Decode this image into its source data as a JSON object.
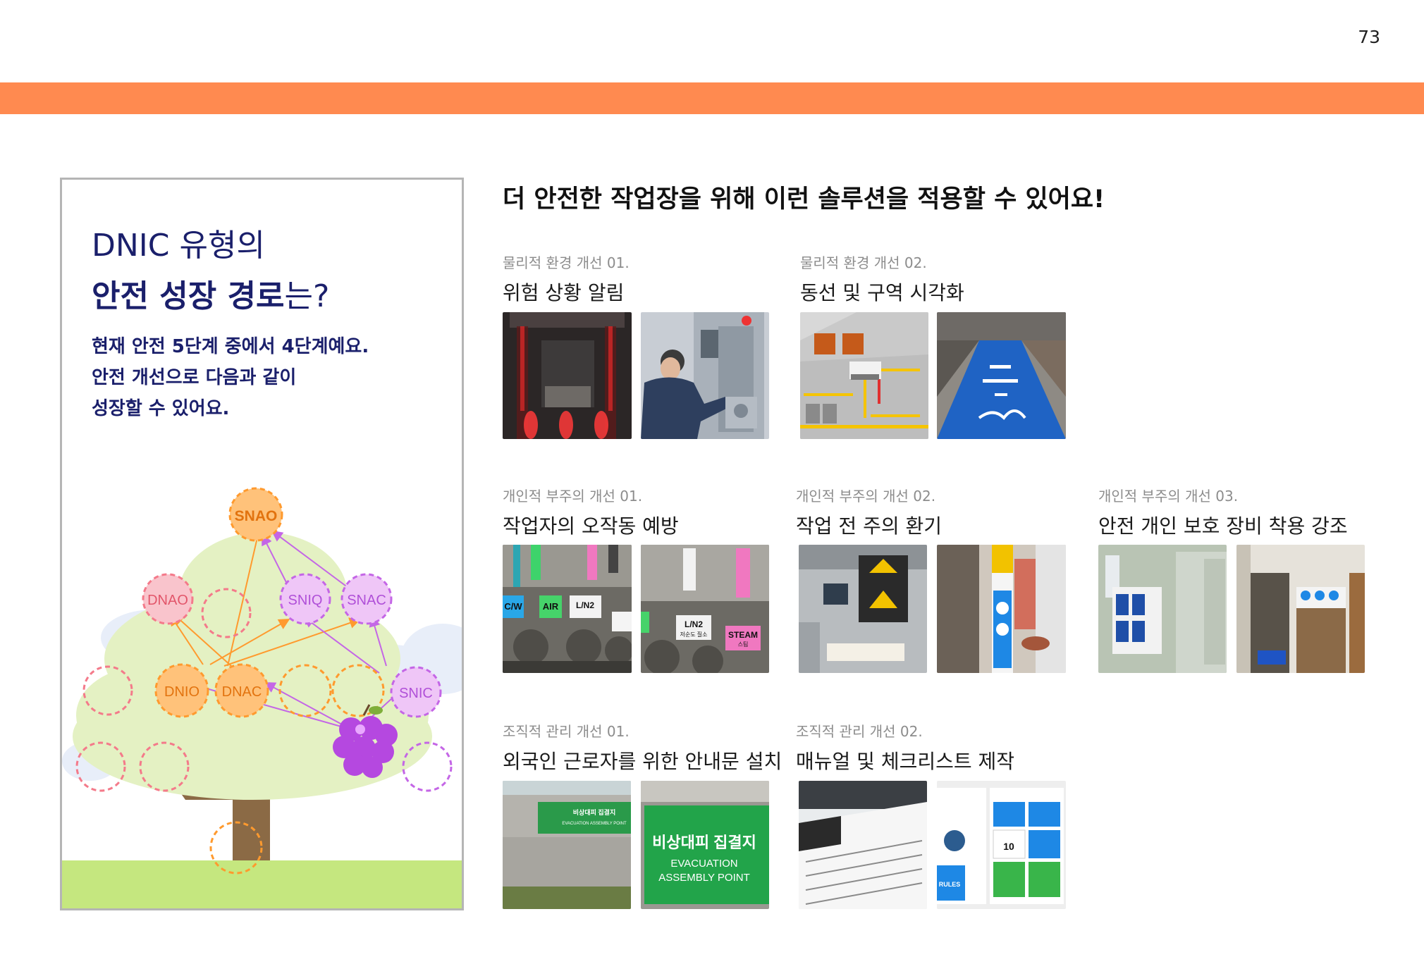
{
  "page_number": "73",
  "panel": {
    "title_line1": "DNIC 유형의",
    "title_line2_bold": "안전 성장 경로",
    "title_line2_rest": "는?",
    "desc_line1": "현재 안전 5단계 중에서 4단계예요.",
    "desc_line2": "안전 개선으로 다음과 같이",
    "desc_line3": "성장할 수 있어요.",
    "nodes": {
      "snao": "SNAO",
      "dnao": "DNAO",
      "sniq": "SNIQ",
      "snac": "SNAC",
      "dnio": "DNIO",
      "dnac": "DNAC",
      "snic": "SNIC"
    }
  },
  "heading": "더 안전한 작업장을 위해 이런 솔루션을 적용할 수 있어요!",
  "solutions": [
    {
      "category": "물리적 환경 개선 01.",
      "title": "위험 상황 알림"
    },
    {
      "category": "물리적 환경 개선 02.",
      "title": "동선 및 구역 시각화"
    },
    {
      "category": "개인적 부주의 개선 01.",
      "title": "작업자의 오작동 예방"
    },
    {
      "category": "개인적 부주의 개선 02.",
      "title": "작업 전 주의 환기"
    },
    {
      "category": "개인적 부주의 개선 03.",
      "title": "안전 개인 보호 장비 착용 강조"
    },
    {
      "category": "조직적 관리 개선 01.",
      "title": "외국인 근로자를 위한 안내문 설치"
    },
    {
      "category": "조직적 관리 개선 02.",
      "title": "매뉴얼 및 체크리스트 제작"
    }
  ],
  "photo_text": {
    "valve_cw": "C/W",
    "valve_air": "AIR",
    "valve_ln2": "L/N2",
    "valve_ln2_sub": "저순도 질소",
    "valve_steam": "STEAM",
    "valve_steam_sub": "스팀",
    "sign1_kr": "비상대피 집결지",
    "sign1_en": "EVACUATION ASSEMBLY POINT",
    "sign2_kr": "비상대피 집결지",
    "sign2_en1": "EVACUATION",
    "sign2_en2": "ASSEMBLY POINT",
    "manual_rules": "RULES",
    "manual_ten": "10"
  },
  "colors": {
    "orange_band": "#FF8A50",
    "navy_text": "#1a1f6b",
    "orange_node": "#FFC27A",
    "pink_node": "#F7A6B2",
    "purple_node": "#E3A6F2",
    "grass": "#C5E77F",
    "foliage": "#E4F1C3"
  }
}
